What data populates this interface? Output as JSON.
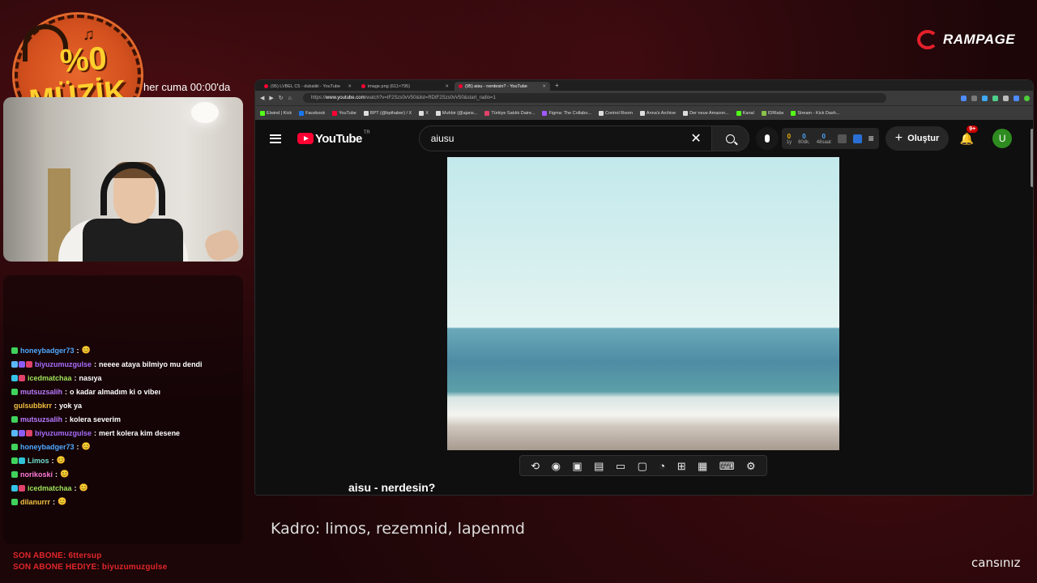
{
  "overlay": {
    "logo": {
      "percent": "%0",
      "word": "MÜZİK"
    },
    "schedule": "her cuma 00:00'da",
    "brand": "RAMPAGE",
    "lineup": "Kadro: limos, rezemnid, lapenmd",
    "tagline": "cansınız",
    "last_sub": "SON ABONE: 6ttersup",
    "last_gift": "SON ABONE HEDIYE: biyuzumuzgulse"
  },
  "chat": [
    {
      "user": "honeybadger73",
      "color": "#4ea8ff",
      "badges": [
        "#3fd35c"
      ],
      "message": "😊"
    },
    {
      "user": "biyuzumuzgulse",
      "color": "#a86dff",
      "badges": [
        "#5ab8ff",
        "#8b5cf6",
        "#e0426a"
      ],
      "message": "neeee ataya bilmiyo mu dendi"
    },
    {
      "user": "icedmatchaa",
      "color": "#9fe35a",
      "badges": [
        "#35c2e6",
        "#e0426a"
      ],
      "message": "nasıya"
    },
    {
      "user": "mutsuzsalih",
      "color": "#b87aff",
      "badges": [
        "#3fd35c"
      ],
      "message": "o kadar almadım ki o vibeı"
    },
    {
      "user": "gulsubbkrr",
      "color": "#f0c040",
      "badges": [],
      "message": "yok ya"
    },
    {
      "user": "mutsuzsalih",
      "color": "#b87aff",
      "badges": [
        "#3fd35c"
      ],
      "message": "kolera severim"
    },
    {
      "user": "biyuzumuzgulse",
      "color": "#a86dff",
      "badges": [
        "#5ab8ff",
        "#8b5cf6",
        "#e0426a"
      ],
      "message": "mert kolera kim desene"
    },
    {
      "user": "honeybadger73",
      "color": "#4ea8ff",
      "badges": [
        "#3fd35c"
      ],
      "message": "😊"
    },
    {
      "user": "Limos",
      "color": "#6fe0d0",
      "badges": [
        "#3fd35c",
        "#2ec4d6"
      ],
      "message": "😊"
    },
    {
      "user": "norikoski",
      "color": "#ff7ad9",
      "badges": [
        "#3fd35c"
      ],
      "message": "😊"
    },
    {
      "user": "icedmatchaa",
      "color": "#9fe35a",
      "badges": [
        "#35c2e6",
        "#e0426a"
      ],
      "message": "😊"
    },
    {
      "user": "dilanurrr",
      "color": "#f0c040",
      "badges": [
        "#3fd35c"
      ],
      "message": "😊"
    }
  ],
  "browser": {
    "tabs": [
      {
        "label": "(95) LVBEL C5 - dubaiiiii - YouTube",
        "active": false
      },
      {
        "label": "image.png (611×795)",
        "active": false
      },
      {
        "label": "(95) aisu - nerdesin? - YouTube",
        "active": true
      }
    ],
    "url_prefix": "https://",
    "url_host": "www.youtube.com",
    "url_rest": "/watch?v=tF2Szs0vV50&list=RDtF2Szs0vV50&start_radio=1",
    "bookmarks": [
      {
        "label": "Elwind | Kick",
        "color": "#53fc18"
      },
      {
        "label": "Facebook",
        "color": "#1877f2"
      },
      {
        "label": "YouTube",
        "color": "#ff0033"
      },
      {
        "label": "BPT (@bpthaber) / X",
        "color": "#dddddd"
      },
      {
        "label": "X",
        "color": "#dddddd"
      },
      {
        "label": "Muhbir (@ajans...",
        "color": "#dddddd"
      },
      {
        "label": "Türkiye Satılık Daire...",
        "color": "#e0426a"
      },
      {
        "label": "Figma: The Collabo...",
        "color": "#a259ff"
      },
      {
        "label": "Control Room",
        "color": "#dddddd"
      },
      {
        "label": "Anna's Archive",
        "color": "#dddddd"
      },
      {
        "label": "Der neue Amazon...",
        "color": "#dddddd"
      },
      {
        "label": "Kanal",
        "color": "#53fc18"
      },
      {
        "label": "IDRlabs",
        "color": "#8bc34a"
      },
      {
        "label": "Stream - Kick Dash...",
        "color": "#53fc18"
      }
    ]
  },
  "youtube": {
    "logo_text": "YouTube",
    "region": "TR",
    "search_value": "aiusu",
    "stats": [
      {
        "value": "0",
        "label": "1y",
        "color": "#f0b400"
      },
      {
        "value": "0",
        "label": "60dk.",
        "color": "#4ea8ff"
      },
      {
        "value": "0",
        "label": "48saat",
        "color": "#4ea8ff"
      }
    ],
    "create_label": "Oluştur",
    "notifications": "9+",
    "avatar_letter": "U",
    "video_title": "aisu - nerdesin?"
  }
}
